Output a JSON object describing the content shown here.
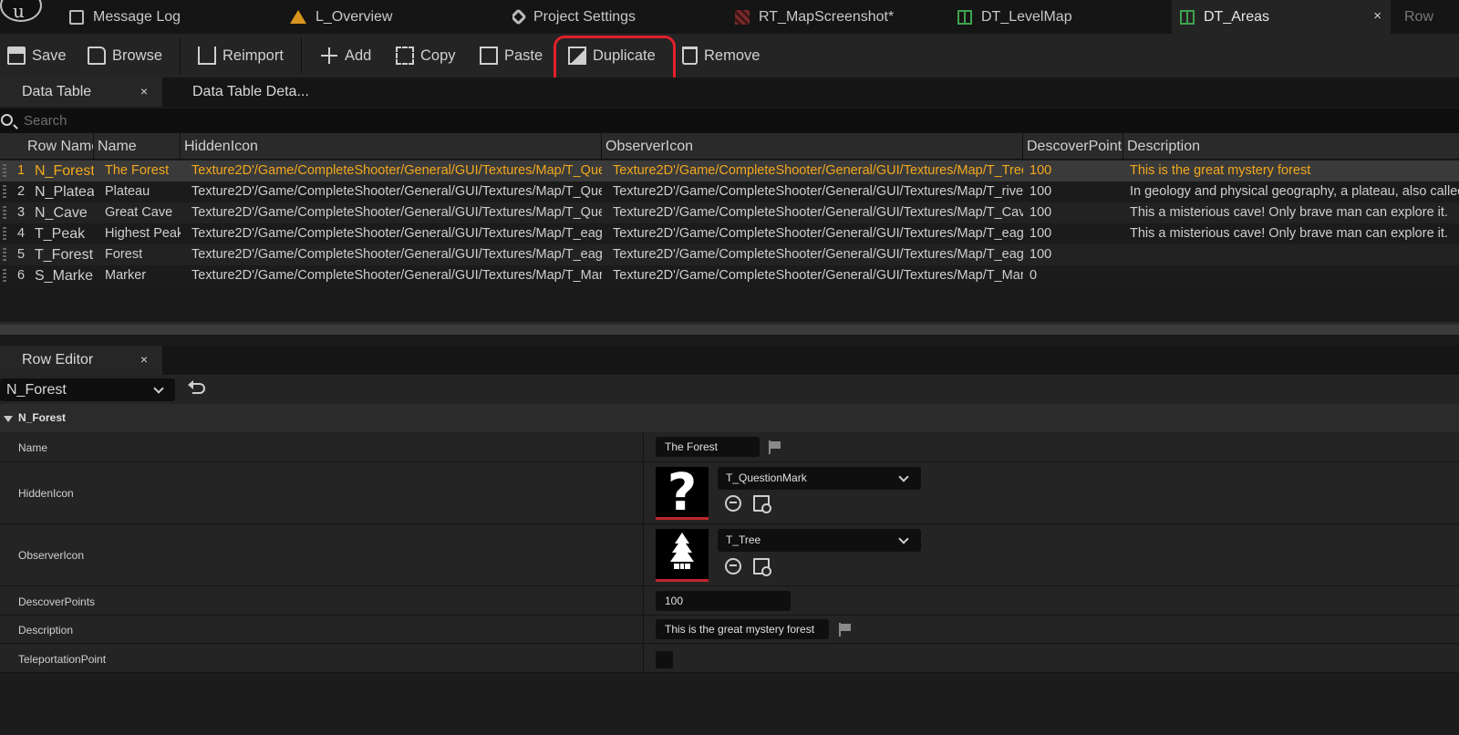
{
  "tabs": [
    {
      "label": "Message Log",
      "icon": "message-log-icon"
    },
    {
      "label": "L_Overview",
      "icon": "level-icon"
    },
    {
      "label": "Project Settings",
      "icon": "settings-icon"
    },
    {
      "label": "RT_MapScreenshot*",
      "icon": "render-target-icon"
    },
    {
      "label": "DT_LevelMap",
      "icon": "data-table-icon"
    },
    {
      "label": "DT_Areas",
      "icon": "data-table-icon",
      "active": true
    },
    {
      "label": "Row"
    }
  ],
  "tab_close_glyph": "×",
  "toolbar": {
    "save": "Save",
    "browse": "Browse",
    "reimport": "Reimport",
    "add": "Add",
    "copy": "Copy",
    "paste": "Paste",
    "duplicate": "Duplicate",
    "remove": "Remove"
  },
  "panel_tabs": {
    "data_table": "Data Table",
    "details": "Data Table Deta..."
  },
  "search": {
    "placeholder": "Search"
  },
  "table": {
    "columns": [
      "Row Name",
      "Name",
      "HiddenIcon",
      "ObserverIcon",
      "DescoverPoints",
      "Description"
    ],
    "rows": [
      {
        "index": "1",
        "row_name": "N_Forest",
        "name": "The Forest",
        "hidden_icon": "Texture2D'/Game/CompleteShooter/General/GUI/Textures/Map/T_QuestionMark",
        "observer_icon": "Texture2D'/Game/CompleteShooter/General/GUI/Textures/Map/T_Tree.T_Tree'",
        "points": "100",
        "description": "This is the great mystery forest",
        "selected": true
      },
      {
        "index": "2",
        "row_name": "N_Plateau",
        "name": "Plateau",
        "hidden_icon": "Texture2D'/Game/CompleteShooter/General/GUI/Textures/Map/T_QuestionMark",
        "observer_icon": "Texture2D'/Game/CompleteShooter/General/GUI/Textures/Map/T_river.T_river'",
        "points": "100",
        "description": "In geology and physical geography, a plateau, also called"
      },
      {
        "index": "3",
        "row_name": "N_Cave",
        "name": "Great Cave",
        "hidden_icon": "Texture2D'/Game/CompleteShooter/General/GUI/Textures/Map/T_QuestionMark",
        "observer_icon": "Texture2D'/Game/CompleteShooter/General/GUI/Textures/Map/T_Cave.T_Cave'",
        "points": "100",
        "description": "This a misterious cave! Only brave man can explore it."
      },
      {
        "index": "4",
        "row_name": "T_Peak",
        "name": "Highest Peak",
        "hidden_icon": "Texture2D'/Game/CompleteShooter/General/GUI/Textures/Map/T_eagle.T_eagle'",
        "observer_icon": "Texture2D'/Game/CompleteShooter/General/GUI/Textures/Map/T_eagle.T_eagle'",
        "points": "100",
        "description": "This a misterious cave! Only brave man can explore it."
      },
      {
        "index": "5",
        "row_name": "T_Forest",
        "name": "Forest",
        "hidden_icon": "Texture2D'/Game/CompleteShooter/General/GUI/Textures/Map/T_eagle.T_eagle'",
        "observer_icon": "Texture2D'/Game/CompleteShooter/General/GUI/Textures/Map/T_eagle.T_eagle'",
        "points": "100",
        "description": ""
      },
      {
        "index": "6",
        "row_name": "S_Marker",
        "name": "Marker",
        "hidden_icon": "Texture2D'/Game/CompleteShooter/General/GUI/Textures/Map/T_Marker.T_Marker'",
        "observer_icon": "Texture2D'/Game/CompleteShooter/General/GUI/Textures/Map/T_Marker.T_Marker'",
        "points": "0",
        "description": ""
      }
    ]
  },
  "row_editor": {
    "tab_label": "Row Editor",
    "selected_row": "N_Forest",
    "category": "N_Forest",
    "fields": {
      "name_label": "Name",
      "name_value": "The Forest",
      "hidden_icon_label": "HiddenIcon",
      "hidden_icon_value": "T_QuestionMark",
      "hidden_icon_glyph": "?",
      "observer_icon_label": "ObserverIcon",
      "observer_icon_value": "T_Tree",
      "points_label": "DescoverPoints",
      "points_value": "100",
      "description_label": "Description",
      "description_value": "This is the great mystery forest",
      "teleport_label": "TeleportationPoint"
    }
  },
  "colors": {
    "selected_text": "#f2a81d",
    "highlight_box": "#e0202a",
    "data_table_icon": "#3fa34d"
  }
}
